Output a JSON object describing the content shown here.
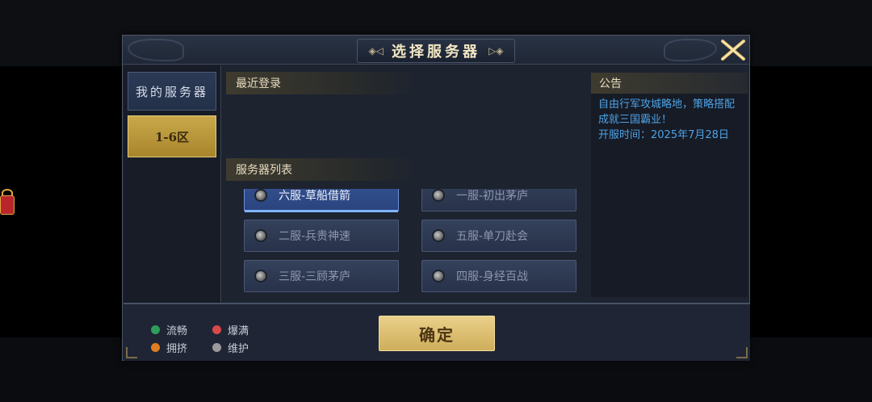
{
  "dialog": {
    "title": "选择服务器",
    "colors": {
      "accent_gold": "#cfae5b",
      "notice_blue": "#4ea2e6",
      "active_blue": "#35528e"
    }
  },
  "sidebar": {
    "my_servers_label": "我的服务器",
    "regions": [
      {
        "label": "1-6区",
        "selected": true
      }
    ]
  },
  "recent": {
    "header": "最近登录"
  },
  "server_list": {
    "header": "服务器列表",
    "items": [
      {
        "label": "六服-草船借箭",
        "status": "维护",
        "selected": true
      },
      {
        "label": "一服-初出茅庐",
        "status": "维护",
        "selected": false
      },
      {
        "label": "二服-兵贵神速",
        "status": "维护",
        "selected": false
      },
      {
        "label": "五服-单刀赴会",
        "status": "维护",
        "selected": false
      },
      {
        "label": "三服-三顾茅庐",
        "status": "维护",
        "selected": false
      },
      {
        "label": "四服-身经百战",
        "status": "维护",
        "selected": false
      }
    ]
  },
  "notice": {
    "header": "公告",
    "lines": [
      "自由行军攻城略地，策略搭配成就三国霸业！",
      "开服时间：2025年7月28日"
    ]
  },
  "legend": {
    "items": [
      {
        "label": "流畅",
        "color": "#2e9e5a"
      },
      {
        "label": "爆满",
        "color": "#d64a4a"
      },
      {
        "label": "拥挤",
        "color": "#e07d22"
      },
      {
        "label": "维护",
        "color": "#9a9a9a"
      }
    ]
  },
  "footer": {
    "confirm_label": "确定"
  }
}
